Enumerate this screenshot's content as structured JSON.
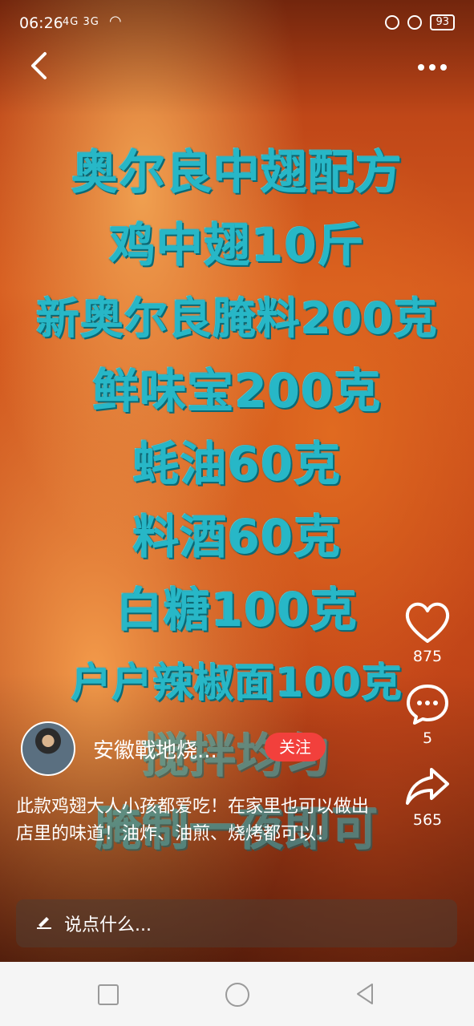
{
  "status": {
    "time": "06:26",
    "signal": "4G 3G",
    "battery": "93"
  },
  "recipe_lines": [
    "奥尔良中翅配方",
    "鸡中翅10斤",
    "新奥尔良腌料200克",
    "鲜味宝200克",
    "蚝油60克",
    "料酒60克",
    "白糖100克",
    "户户辣椒面100克",
    "搅拌均匀",
    "腌制一夜即可"
  ],
  "author": {
    "name": "安徽戰地烧...",
    "follow_label": "关注"
  },
  "caption": "此款鸡翅大人小孩都爱吃！在家里也可以做出店里的味道！油炸、油煎、烧烤都可以！",
  "actions": {
    "likes": "875",
    "comments": "5",
    "shares": "565"
  },
  "comment_input": {
    "placeholder": "说点什么..."
  },
  "icons": [
    "back-icon",
    "more-icon",
    "heart-icon",
    "comment-icon",
    "share-icon",
    "pencil-icon",
    "nav-recent-icon",
    "nav-home-icon",
    "nav-back-icon"
  ]
}
